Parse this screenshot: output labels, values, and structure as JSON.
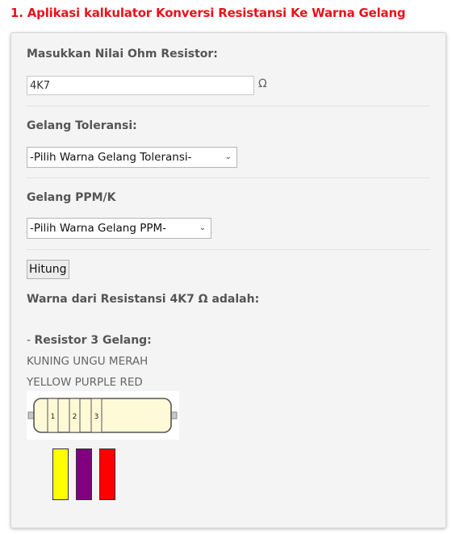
{
  "page": {
    "title": "1. Aplikasi kalkulator Konversi Resistansi Ke Warna Gelang"
  },
  "form": {
    "ohm_label": "Masukkan Nilai Ohm Resistor:",
    "ohm_value": "4K7",
    "ohm_unit": "Ω",
    "tolerance_label": "Gelang Toleransi:",
    "tolerance_select": "-Pilih Warna Gelang Toleransi-",
    "ppm_label": "Gelang PPM/K",
    "ppm_select": "-Pilih Warna Gelang PPM-",
    "button": "Hitung"
  },
  "result": {
    "title": "Warna dari Resistansi 4K7 Ω adalah:",
    "band_prefix": "- ",
    "band_heading": "Resistor 3 Gelang:",
    "colors_id": "KUNING UNGU MERAH",
    "colors_en": "YELLOW PURPLE RED",
    "band_numbers": [
      "1",
      "2",
      "3"
    ],
    "swatches": [
      "#ffff00",
      "#800080",
      "#ff0000"
    ]
  },
  "colors": {
    "title": "#e8131a"
  }
}
